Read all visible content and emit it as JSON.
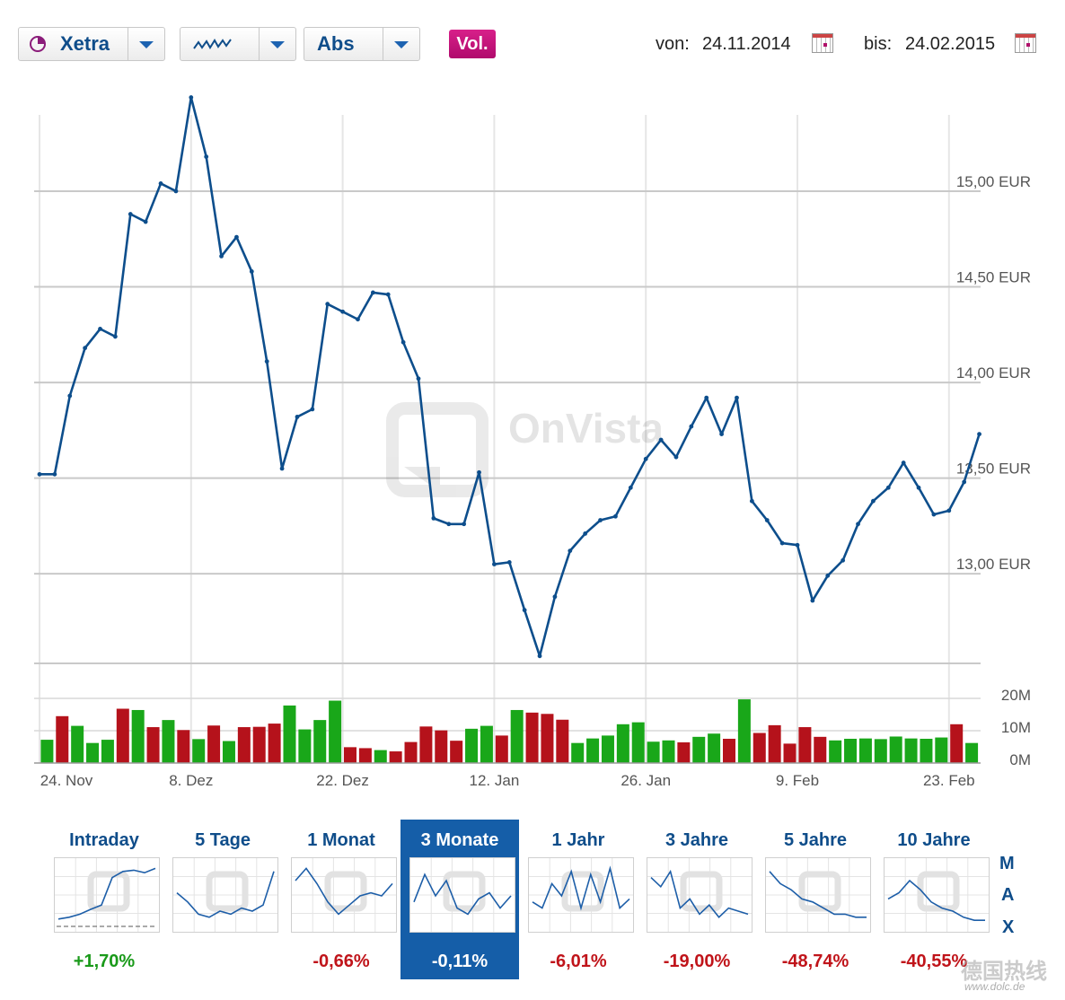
{
  "toolbar": {
    "exchange": "Xetra",
    "scale": "Abs",
    "volume_button": "Vol.",
    "from_label": "von:",
    "from_date": "24.11.2014",
    "to_label": "bis:",
    "to_date": "24.02.2015"
  },
  "colors": {
    "line": "#0d4e8c",
    "vol_up": "#19a719",
    "vol_down": "#b5121b",
    "accent": "#155ea8",
    "brand_button": "#c3127a"
  },
  "chart_data": {
    "type": "line",
    "watermark": "OnVista",
    "price_series": {
      "values": [
        13.52,
        13.52,
        13.93,
        14.18,
        14.28,
        14.24,
        14.88,
        14.84,
        15.04,
        15.0,
        15.49,
        15.18,
        14.66,
        14.76,
        14.58,
        14.11,
        13.55,
        13.82,
        13.86,
        14.41,
        14.37,
        14.33,
        14.47,
        14.46,
        14.21,
        14.02,
        13.29,
        13.26,
        13.26,
        13.53,
        13.05,
        13.06,
        12.81,
        12.57,
        12.88,
        13.12,
        13.21,
        13.28,
        13.3,
        13.45,
        13.6,
        13.7,
        13.61,
        13.77,
        13.92,
        13.73,
        13.92,
        13.38,
        13.28,
        13.16,
        13.15,
        12.86,
        12.99,
        13.07,
        13.26,
        13.38,
        13.45,
        13.58,
        13.45,
        13.31,
        13.33,
        13.48,
        13.73
      ],
      "ylim": [
        12.48,
        15.53
      ],
      "yticks": [
        13.0,
        13.5,
        14.0,
        14.5,
        15.0
      ],
      "ytick_labels": [
        "13,00 EUR",
        "13,50 EUR",
        "14,00 EUR",
        "14,50 EUR",
        "15,00 EUR"
      ]
    },
    "volume_series": {
      "values": [
        7.2,
        14.5,
        11.5,
        6.2,
        7.2,
        16.8,
        16.4,
        11.1,
        13.3,
        10.2,
        7.4,
        11.6,
        6.8,
        11.1,
        11.2,
        12.2,
        17.8,
        10.4,
        13.3,
        19.3,
        4.9,
        4.6,
        4.0,
        3.6,
        6.5,
        11.3,
        10.1,
        6.9,
        10.6,
        11.5,
        8.5,
        16.4,
        15.6,
        15.2,
        13.4,
        6.2,
        7.6,
        8.5,
        12.0,
        12.6,
        6.6,
        7.0,
        6.4,
        8.1,
        9.1,
        7.5,
        19.7,
        9.3,
        11.7,
        6.0,
        11.1,
        8.1,
        7.0,
        7.5,
        7.6,
        7.4,
        8.2,
        7.6,
        7.5,
        7.9,
        12.0,
        6.2
      ],
      "up": [
        true,
        false,
        true,
        true,
        true,
        false,
        true,
        false,
        true,
        false,
        true,
        false,
        true,
        false,
        false,
        false,
        true,
        true,
        true,
        true,
        false,
        false,
        true,
        false,
        false,
        false,
        false,
        false,
        true,
        true,
        false,
        true,
        false,
        false,
        false,
        true,
        true,
        true,
        true,
        true,
        true,
        true,
        false,
        true,
        true,
        false,
        true,
        false,
        false,
        false,
        false,
        false,
        true,
        true,
        true,
        true,
        true,
        true,
        true,
        true,
        false,
        true
      ],
      "ylim": [
        0,
        24
      ],
      "yticks": [
        0,
        10,
        20
      ],
      "ytick_labels": [
        "0M",
        "10M",
        "20M"
      ]
    },
    "x_ticks": [
      "24. Nov",
      "8. Dez",
      "22. Dez",
      "12. Jan",
      "26. Jan",
      "9. Feb",
      "23. Feb"
    ],
    "x_tick_index": [
      0,
      10,
      20,
      30,
      40,
      50,
      60
    ],
    "grid": true
  },
  "periods": [
    {
      "label": "Intraday",
      "change": "+1,70%",
      "direction": "pos",
      "active": false,
      "spark": [
        0.12,
        0.15,
        0.2,
        0.28,
        0.35,
        0.8,
        0.9,
        0.92,
        0.88,
        0.95
      ]
    },
    {
      "label": "5 Tage",
      "change": "",
      "direction": "none",
      "active": false,
      "spark": [
        0.55,
        0.4,
        0.2,
        0.15,
        0.25,
        0.2,
        0.3,
        0.25,
        0.35,
        0.9
      ]
    },
    {
      "label": "1 Monat",
      "change": "-0,66%",
      "direction": "neg",
      "active": false,
      "spark": [
        0.75,
        0.95,
        0.7,
        0.4,
        0.2,
        0.35,
        0.5,
        0.55,
        0.5,
        0.7
      ]
    },
    {
      "label": "3 Monate",
      "change": "-0,11%",
      "direction": "neg",
      "active": true,
      "spark": [
        0.4,
        0.85,
        0.5,
        0.75,
        0.3,
        0.2,
        0.45,
        0.55,
        0.3,
        0.5
      ]
    },
    {
      "label": "1 Jahr",
      "change": "-6,01%",
      "direction": "neg",
      "active": false,
      "spark": [
        0.4,
        0.3,
        0.7,
        0.5,
        0.9,
        0.3,
        0.85,
        0.4,
        0.95,
        0.3,
        0.45
      ]
    },
    {
      "label": "3 Jahre",
      "change": "-19,00%",
      "direction": "neg",
      "active": false,
      "spark": [
        0.8,
        0.65,
        0.9,
        0.3,
        0.45,
        0.2,
        0.35,
        0.15,
        0.3,
        0.25,
        0.2
      ]
    },
    {
      "label": "5 Jahre",
      "change": "-48,74%",
      "direction": "neg",
      "active": false,
      "spark": [
        0.9,
        0.7,
        0.6,
        0.45,
        0.4,
        0.3,
        0.2,
        0.2,
        0.15,
        0.15
      ]
    },
    {
      "label": "10 Jahre",
      "change": "-40,55%",
      "direction": "neg",
      "active": false,
      "spark": [
        0.45,
        0.55,
        0.75,
        0.6,
        0.4,
        0.3,
        0.25,
        0.15,
        0.1,
        0.1
      ]
    }
  ],
  "max_letters": [
    "M",
    "A",
    "X"
  ],
  "watermark_site": "德国热线",
  "watermark_url": "www.dolc.de"
}
